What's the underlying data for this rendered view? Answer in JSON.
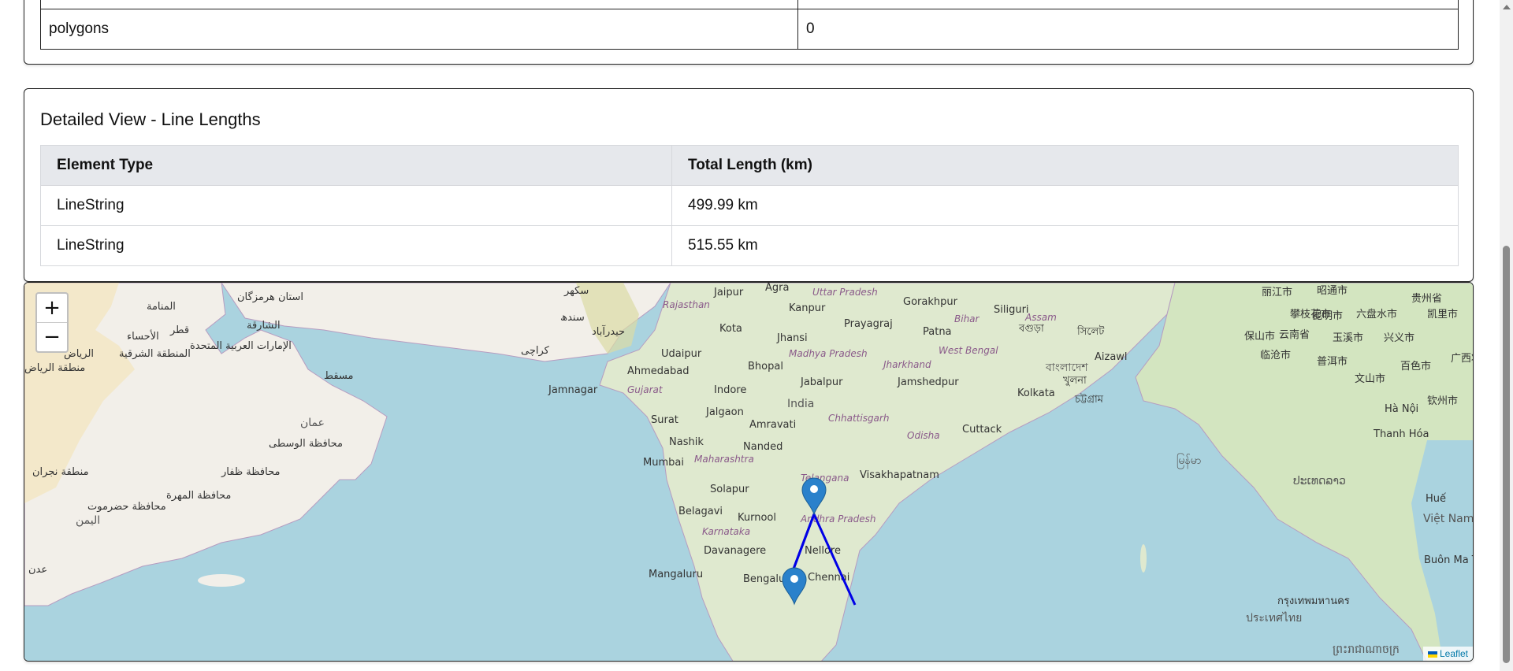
{
  "summary_table": {
    "rows": [
      {
        "label": "",
        "value": ""
      },
      {
        "label": "polygons",
        "value": "0"
      }
    ]
  },
  "lengths": {
    "title": "Detailed View - Line Lengths",
    "headers": [
      "Element Type",
      "Total Length (km)"
    ],
    "rows": [
      {
        "type": "LineString",
        "length": "499.99 km"
      },
      {
        "type": "LineString",
        "length": "515.55 km"
      }
    ]
  },
  "map": {
    "zoom_in": "+",
    "zoom_out": "−",
    "attribution": "Leaflet",
    "line_color": "#0000e6",
    "marker_color": "#2a81cb",
    "labels": {
      "jaipur": "Jaipur",
      "agra": "Agra",
      "uttar_pradesh": "Uttar Pradesh",
      "gorakhpur": "Gorakhpur",
      "siliguri": "Siliguri",
      "rajasthan": "Rajasthan",
      "kanpur": "Kanpur",
      "prayagraj": "Prayagraj",
      "patna": "Patna",
      "bihar": "Bihar",
      "assam": "Assam",
      "kota": "Kota",
      "jhansi": "Jhansi",
      "udaipur": "Udaipur",
      "madhya_pradesh": "Madhya Pradesh",
      "west_bengal": "West Bengal",
      "ahmedabad": "Ahmedabad",
      "bhopal": "Bhopal",
      "jharkhand": "Jharkhand",
      "aizawl": "Aizawl",
      "jamnagar": "Jamnagar",
      "gujarat": "Gujarat",
      "indore": "Indore",
      "jabalpur": "Jabalpur",
      "jamshedpur": "Jamshedpur",
      "india": "India",
      "kolkata": "Kolkata",
      "jalgaon": "Jalgaon",
      "surat": "Surat",
      "amravati": "Amravati",
      "chhattisgarh": "Chhattisgarh",
      "odisha": "Odisha",
      "cuttack": "Cuttack",
      "nashik": "Nashik",
      "nanded": "Nanded",
      "mumbai": "Mumbai",
      "maharashtra": "Maharashtra",
      "telangana": "Telangana",
      "visakhapatnam": "Visakhapatnam",
      "solapur": "Solapur",
      "belagavi": "Belagavi",
      "kurnool": "Kurnool",
      "andhra_pradesh": "Andhra Pradesh",
      "karnataka": "Karnataka",
      "davanagere": "Davanagere",
      "nellore": "Nellore",
      "mangaluru": "Mangaluru",
      "bengaluru": "Bengaluru",
      "chennai": "Chennai",
      "karachi": "كراچی",
      "sindh": "سندھ",
      "hyderabad_pk": "حیدرآباد",
      "sukkur": "سکھر",
      "muscat": "مسقط",
      "oman": "عمان",
      "uae": "الإمارات العربية المتحدة",
      "sharjah": "الشارقة",
      "qatar": "قطر",
      "manama": "المنامة",
      "riyadh": "الرياض",
      "ahsa": "الأحساء",
      "eastern_province": "المنطقة الشرقية",
      "riyadh_region": "منطقة الرياض",
      "yemen": "اليمن",
      "aden": "عدن",
      "najran": "منطقة نجران",
      "dhofar": "محافظة ظفار",
      "wusta": "محافظة الوسطى",
      "mahrah": "محافظة المهرة",
      "hadramaut": "محافظة حضرموت",
      "hormozgan": "استان هرمزگان",
      "hanoi": "Hà Nội",
      "thanh_hoa": "Thanh Hóa",
      "hue": "Huế",
      "viet_nam": "Việt Nam",
      "buon_ma_thuot": "Buôn Ma Thuột",
      "bangladesh": "বাংলাদেশ",
      "khulna": "খুলনা",
      "chattogram": "চট্টগ্রাম",
      "sylhet": "সিলেট",
      "bogura": "বগুড়া",
      "kunming": "昆明市",
      "yunnan": "云南省",
      "guizhou": "贵州省",
      "baoshan": "保山市",
      "lincang": "临沧市",
      "puer": "普洱市",
      "wenshan": "文山市",
      "liupanshui": "六盘水市",
      "panzhihua": "攀枝花市",
      "kaili": "凯里市",
      "lijiang": "丽江市",
      "zhaotong": "昭通市",
      "xingyi": "兴义市",
      "yuxi": "玉溪市",
      "baise": "百色市",
      "qinzhou": "钦州市",
      "guangxi": "广西壮族",
      "myanmar": "မြန်မာ",
      "thailand": "ประเทศไทย",
      "bangkok": "กรุงเทพมหานคร",
      "cambodia": "ព្រះរាជាណាចក្រ",
      "laos": "ປະເທດລາວ"
    }
  }
}
